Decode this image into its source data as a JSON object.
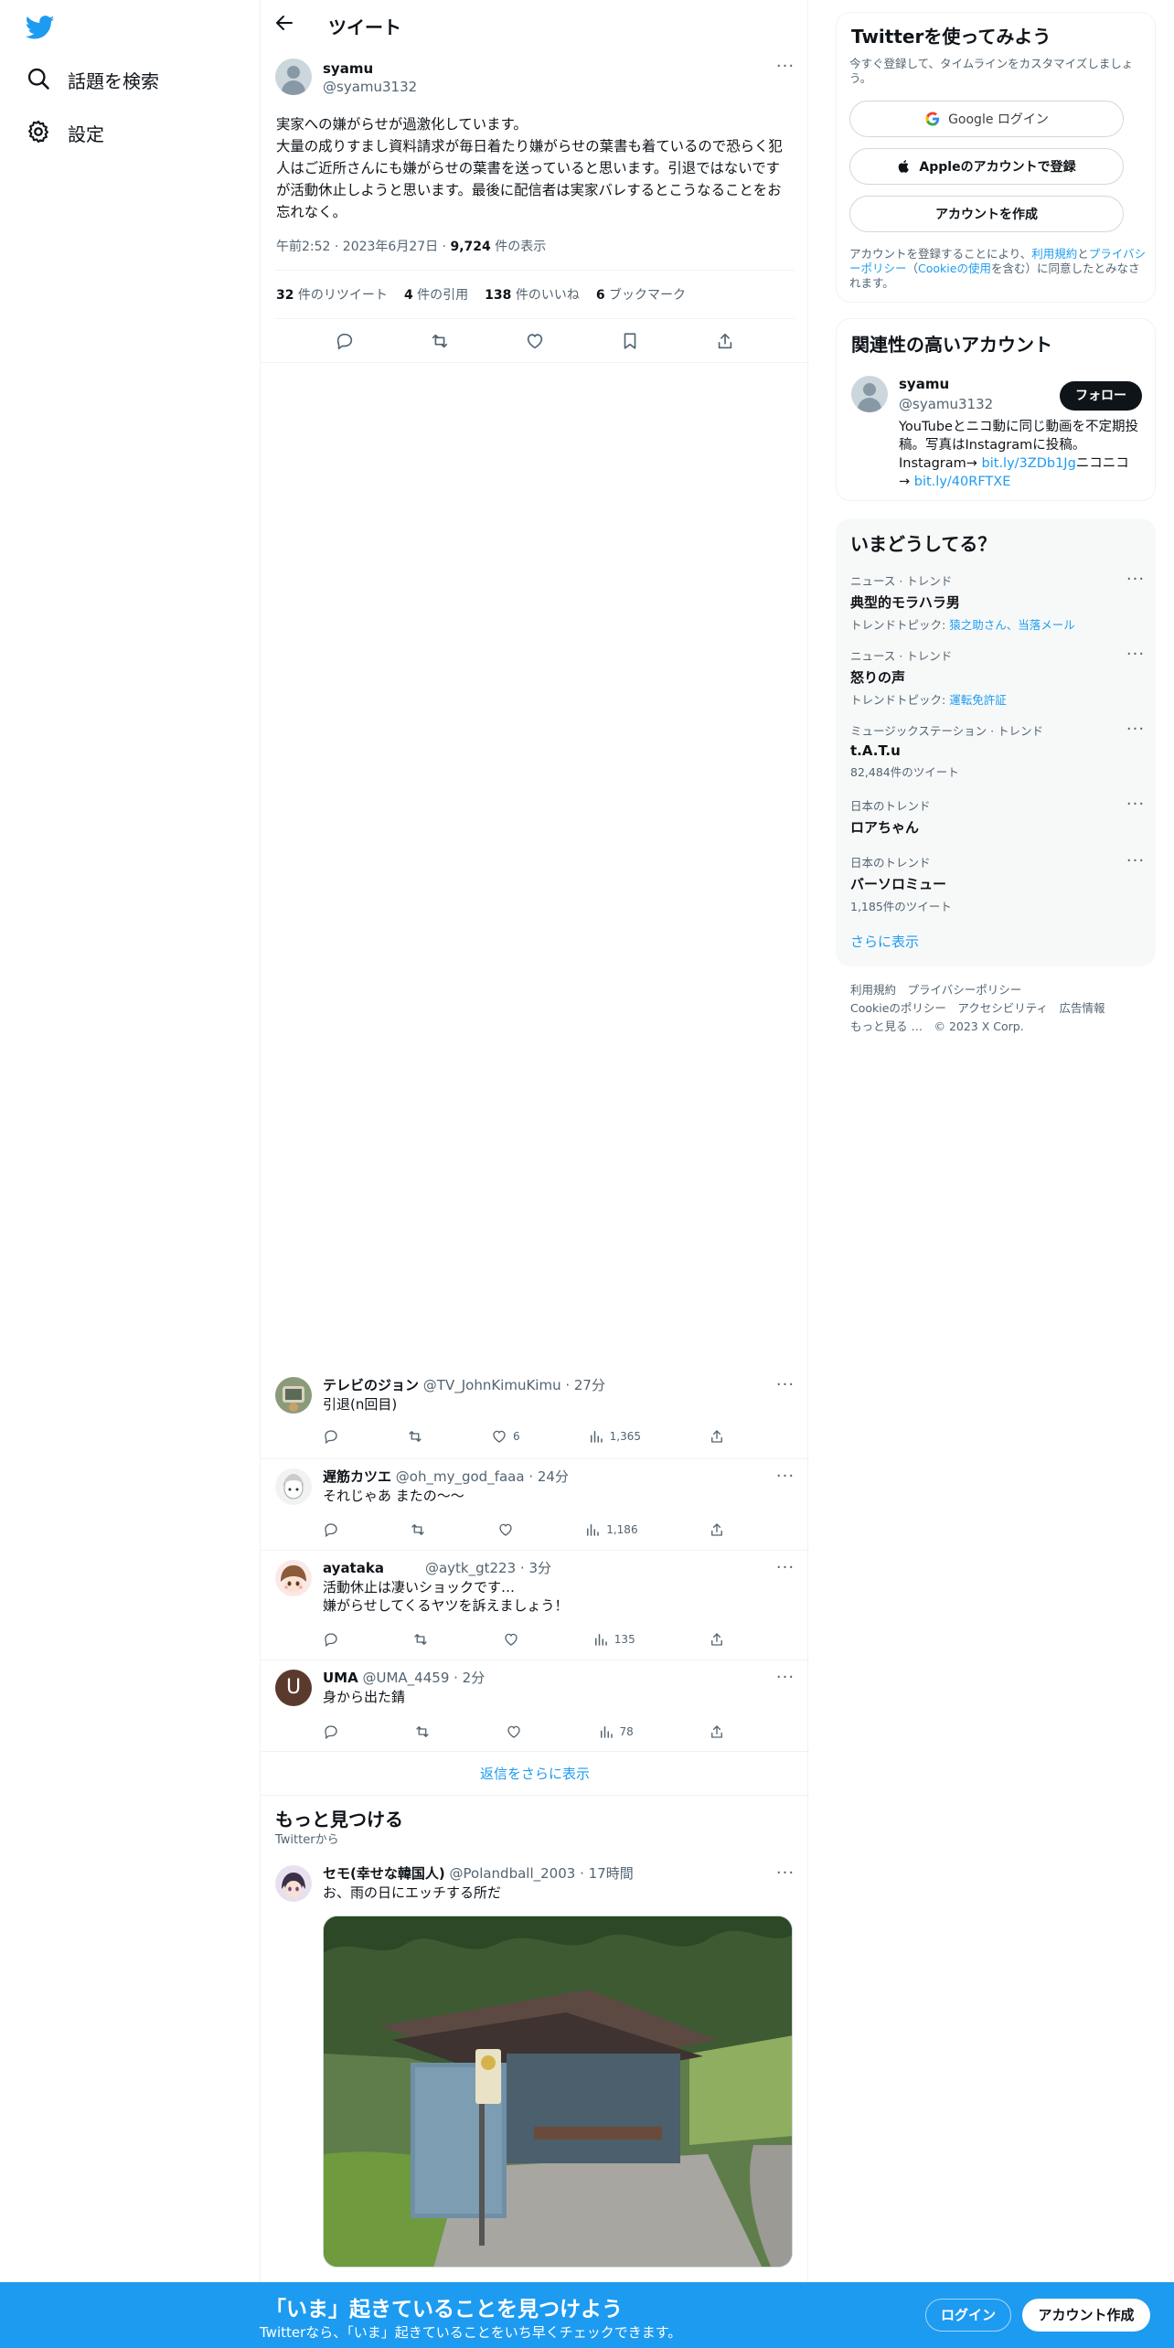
{
  "nav": {
    "items": [
      {
        "label": "話題を検索",
        "icon": "search-icon"
      },
      {
        "label": "設定",
        "icon": "gear-icon"
      }
    ]
  },
  "header": {
    "title": "ツイート"
  },
  "tweet": {
    "name": "syamu",
    "handle": "@syamu3132",
    "text": "実家への嫌がらせが過激化しています。\n大量の成りすまし資料請求が毎日着たり嫌がらせの葉書も着ているので恐らく犯人はご近所さんにも嫌がらせの葉書を送っていると思います。引退ではないですが活動休止しようと思います。最後に配信者は実家バレするとこうなることをお忘れなく。",
    "time": "午前2:52 · 2023年6月27日 · ",
    "views": "9,724",
    "views_label": " 件の表示",
    "retweets": "32",
    "retweets_label": " 件のリツイート",
    "quotes": "4",
    "quotes_label": " 件の引用",
    "likes": "138",
    "likes_label": " 件のいいね",
    "bookmarks": "6",
    "bookmarks_label": " ブックマーク"
  },
  "replies": [
    {
      "name": "テレビのジョン",
      "handle": "@TV_JohnKimuKimu · 27分",
      "text": "引退(n回目)",
      "likes": "6",
      "views": "1,365"
    },
    {
      "name": "遅筋カツエ",
      "handle": "@oh_my_god_faaa · 24分",
      "text": "それじゃあ またの〜〜",
      "likes": "",
      "views": "1,186"
    },
    {
      "name": "ayataka",
      "handle": "@aytk_gt223 · 3分",
      "text": "活動休止は凄いショックです…\n嫌がらせしてくるヤツを訴えましょう！",
      "likes": "",
      "views": "135"
    },
    {
      "name": "UMA",
      "handle": "@UMA_4459 · 2分",
      "text": "身から出た錆",
      "likes": "",
      "views": "78",
      "avatar_letter": "U"
    }
  ],
  "show_more_replies": "返信をさらに表示",
  "discover": {
    "title": "もっと見つける",
    "sub": "Twitterから",
    "post": {
      "name": "セモ(幸せな韓国人)",
      "handle": "@Polandball_2003 · 17時間",
      "text": "お、雨の日にエッチする所だ"
    }
  },
  "signup_card": {
    "title": "Twitterを使ってみよう",
    "sub": "今すぐ登録して、タイムラインをカスタマイズしましょう。",
    "google": "Google ログイン",
    "apple": "Appleのアカウントで登録",
    "create": "アカウントを作成",
    "legal_1": "アカウントを登録することにより、",
    "legal_tos": "利用規約",
    "legal_2": "と",
    "legal_pp": "プライバシーポリシー",
    "legal_3": "（",
    "legal_cookie": "Cookieの使用",
    "legal_4": "を含む）に同意したとみなされます。"
  },
  "related": {
    "title": "関連性の高いアカウント",
    "name": "syamu",
    "handle": "@syamu3132",
    "follow": "フォロー",
    "bio_1": "YouTubeとニコ動に同じ動画を不定期投稿。写真はInstagramに投稿。Instagram→ ",
    "bio_link1": "bit.ly/3ZDb1Jg",
    "bio_2": "ニコニコ→ ",
    "bio_link2": "bit.ly/40RFTXE"
  },
  "trends": {
    "title": "いまどうしてる？",
    "items": [
      {
        "cat": "ニュース · トレンド",
        "name": "典型的モラハラ男",
        "sub_label": "トレンドトピック: ",
        "sub_links": "猿之助さん、当落メール"
      },
      {
        "cat": "ニュース · トレンド",
        "name": "怒りの声",
        "sub_label": "トレンドトピック: ",
        "sub_links": "運転免許証"
      },
      {
        "cat": "ミュージックステーション · トレンド",
        "name": "t.A.T.u",
        "sub_label": "82,484件のツイート",
        "sub_links": ""
      },
      {
        "cat": "日本のトレンド",
        "name": "ロアちゃん",
        "sub_label": "",
        "sub_links": ""
      },
      {
        "cat": "日本のトレンド",
        "name": "バーソロミュー",
        "sub_label": "1,185件のツイート",
        "sub_links": ""
      }
    ],
    "show_more": "さらに表示"
  },
  "footer": {
    "line1": "利用規約　プライバシーポリシー",
    "line2": "Cookieのポリシー　アクセシビリティ　広告情報",
    "line3": "もっと見る …　© 2023 X Corp."
  },
  "bottom_bar": {
    "title": "「いま」起きていることを見つけよう",
    "sub": "Twitterなら、「いま」起きていることをいち早くチェックできます。",
    "login": "ログイン",
    "signup": "アカウント作成"
  },
  "colors": {
    "accent": "#1d9bf0",
    "text": "#0f1419",
    "muted": "#536471",
    "bottom_bar": "#1d9bf0"
  }
}
